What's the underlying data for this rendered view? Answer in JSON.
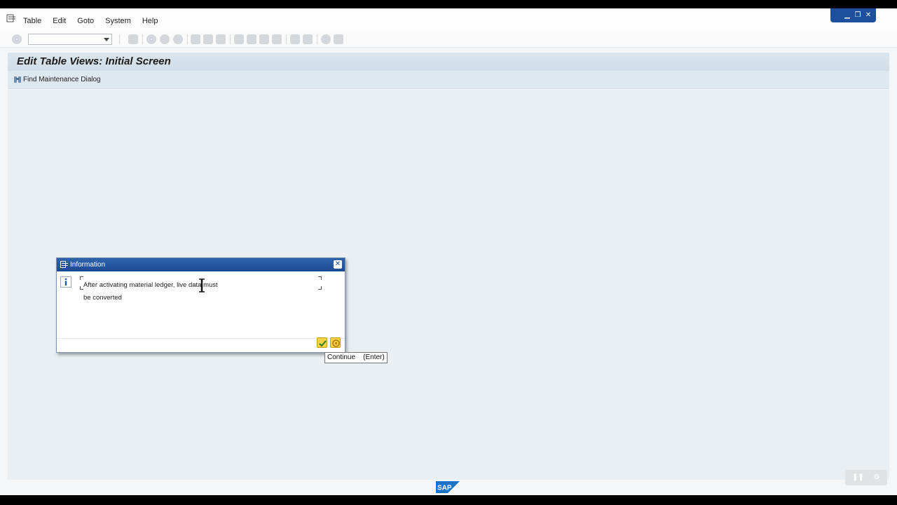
{
  "menubar": {
    "items": [
      {
        "label": "Table"
      },
      {
        "label": "Edit"
      },
      {
        "label": "Goto"
      },
      {
        "label": "System"
      },
      {
        "label": "Help"
      }
    ]
  },
  "toolbar": {
    "command_field_value": ""
  },
  "page": {
    "title": "Edit Table Views: Initial Screen"
  },
  "app_toolbar": {
    "find_label": "Find Maintenance Dialog"
  },
  "dialog": {
    "title": "Information",
    "message_line1": "After activating material ledger, live data must",
    "message_line2": "be converted"
  },
  "tooltip": {
    "text": "Continue    (Enter)"
  },
  "branding": {
    "logo_text": "SAP"
  },
  "icons": {
    "menu": "menu-icon",
    "info": "info-icon",
    "ok": "checkmark-icon",
    "help": "help-icon",
    "close": "close-icon"
  },
  "colors": {
    "dialog_title": "#1c4a93",
    "title_bar": "#d6e2eb",
    "content_bg": "#e9eff3",
    "ok_button": "#f4d246"
  }
}
